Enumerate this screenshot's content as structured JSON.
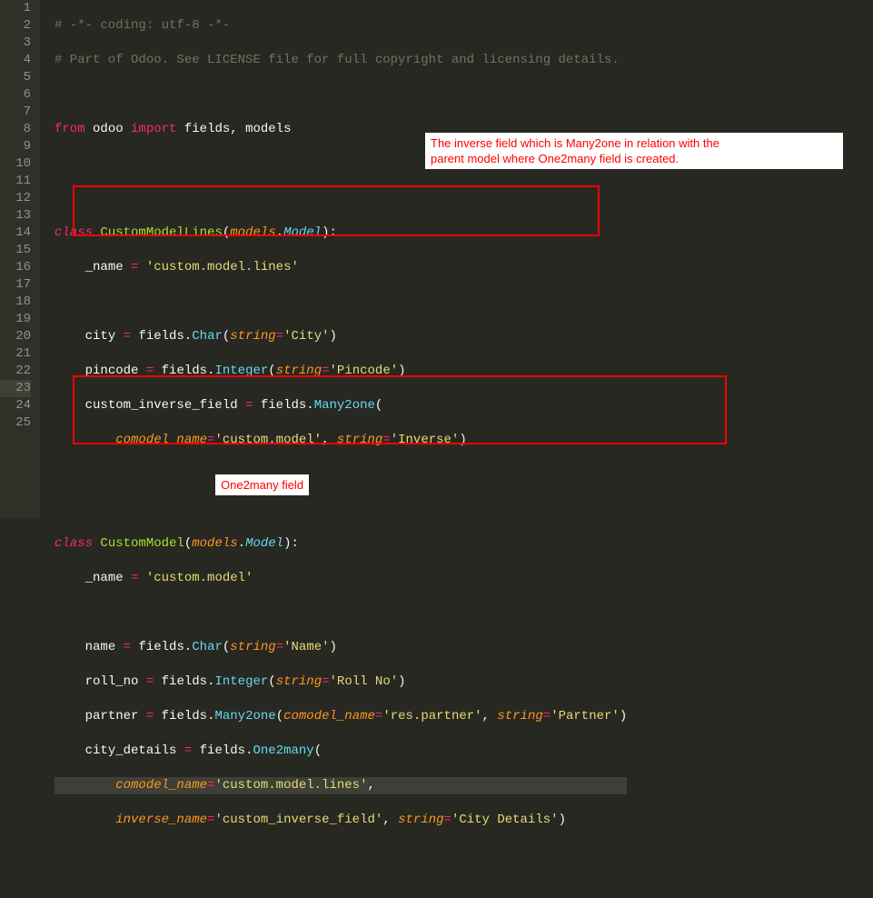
{
  "gutter": {
    "lines": [
      "1",
      "2",
      "3",
      "4",
      "5",
      "6",
      "7",
      "8",
      "9",
      "10",
      "11",
      "12",
      "13",
      "14",
      "15",
      "16",
      "17",
      "18",
      "19",
      "20",
      "21",
      "22",
      "23",
      "24",
      "25"
    ],
    "active": 23
  },
  "code": {
    "l1": {
      "comment": "# -*- coding: utf-8 -*-"
    },
    "l2": {
      "comment": "# Part of Odoo. See LICENSE file for full copyright and licensing details."
    },
    "l4": {
      "kw_from": "from",
      "mod1": "odoo",
      "kw_import": "import",
      "names": "fields, models"
    },
    "l7": {
      "kw_class": "class",
      "cls": "CustomModelLines",
      "arg": "models",
      "attr": "Model"
    },
    "l8": {
      "id": "_name",
      "eq": "=",
      "str": "'custom.model.lines'"
    },
    "l10": {
      "id": "city",
      "eq": "=",
      "mod": "fields",
      "fn": "Char",
      "arg": "string",
      "str": "'City'"
    },
    "l11": {
      "id": "pincode",
      "eq": "=",
      "mod": "fields",
      "fn": "Integer",
      "arg": "string",
      "str": "'Pincode'"
    },
    "l12": {
      "id": "custom_inverse_field",
      "eq": "=",
      "mod": "fields",
      "fn": "Many2one"
    },
    "l13": {
      "arg1": "comodel_name",
      "str1": "'custom.model'",
      "arg2": "string",
      "str2": "'Inverse'"
    },
    "l16": {
      "kw_class": "class",
      "cls": "CustomModel",
      "arg": "models",
      "attr": "Model"
    },
    "l17": {
      "id": "_name",
      "eq": "=",
      "str": "'custom.model'"
    },
    "l19": {
      "id": "name",
      "eq": "=",
      "mod": "fields",
      "fn": "Char",
      "arg": "string",
      "str": "'Name'"
    },
    "l20": {
      "id": "roll_no",
      "eq": "=",
      "mod": "fields",
      "fn": "Integer",
      "arg": "string",
      "str": "'Roll No'"
    },
    "l21": {
      "id": "partner",
      "eq": "=",
      "mod": "fields",
      "fn": "Many2one",
      "arg1": "comodel_name",
      "str1": "'res.partner'",
      "arg2": "string",
      "str2": "'Partner'"
    },
    "l22": {
      "id": "city_details",
      "eq": "=",
      "mod": "fields",
      "fn": "One2many"
    },
    "l23": {
      "arg1": "comodel_name",
      "str1": "'custom.model.lines'"
    },
    "l24": {
      "arg1": "inverse_name",
      "str1": "'custom_inverse_field'",
      "arg2": "string",
      "str2": "'City Details'"
    }
  },
  "annotations": {
    "callout1_line1": "The inverse field which is Many2one in relation with the",
    "callout1_line2": "parent model where One2many field is created.",
    "callout2": "One2many field"
  }
}
